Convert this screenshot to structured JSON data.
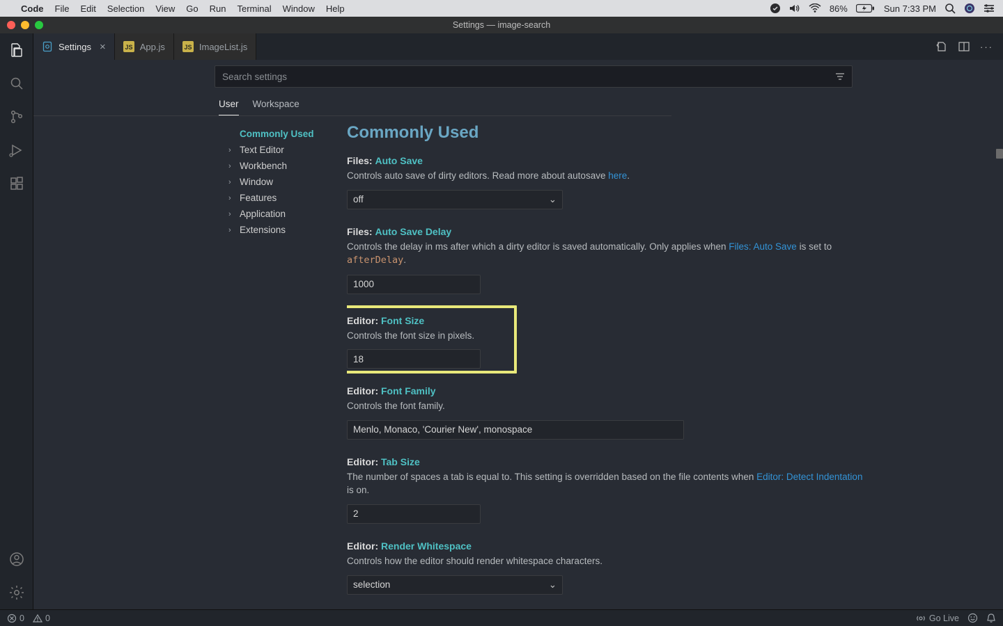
{
  "mac_menu": {
    "items": [
      "Code",
      "File",
      "Edit",
      "Selection",
      "View",
      "Go",
      "Run",
      "Terminal",
      "Window",
      "Help"
    ],
    "battery": "86%",
    "clock": "Sun 7:33 PM"
  },
  "title_bar": {
    "title": "Settings — image-search"
  },
  "tabs": {
    "items": [
      {
        "label": "Settings",
        "active": true,
        "icon": "settings"
      },
      {
        "label": "App.js",
        "active": false,
        "icon": "js"
      },
      {
        "label": "ImageList.js",
        "active": false,
        "icon": "js"
      }
    ]
  },
  "settings": {
    "search_placeholder": "Search settings",
    "scopes": [
      "User",
      "Workspace"
    ],
    "active_scope": 0,
    "toc": [
      "Commonly Used",
      "Text Editor",
      "Workbench",
      "Window",
      "Features",
      "Application",
      "Extensions"
    ],
    "active_toc": 0,
    "heading": "Commonly Used",
    "items": {
      "autosave": {
        "cat": "Files:",
        "name": "Auto Save",
        "desc_a": "Controls auto save of dirty editors. Read more about autosave ",
        "link": "here",
        "desc_b": ".",
        "value": "off"
      },
      "autosave_delay": {
        "cat": "Files:",
        "name": "Auto Save Delay",
        "desc_a": "Controls the delay in ms after which a dirty editor is saved automatically. Only applies when ",
        "link": "Files: Auto Save",
        "desc_b": " is set to ",
        "code": "afterDelay",
        "desc_c": ".",
        "value": "1000"
      },
      "font_size": {
        "cat": "Editor:",
        "name": "Font Size",
        "desc": "Controls the font size in pixels.",
        "value": "18"
      },
      "font_family": {
        "cat": "Editor:",
        "name": "Font Family",
        "desc": "Controls the font family.",
        "value": "Menlo, Monaco, 'Courier New', monospace"
      },
      "tab_size": {
        "cat": "Editor:",
        "name": "Tab Size",
        "desc_a": "The number of spaces a tab is equal to. This setting is overridden based on the file contents when ",
        "link": "Editor: Detect Indentation",
        "desc_b": " is on.",
        "value": "2"
      },
      "render_ws": {
        "cat": "Editor:",
        "name": "Render Whitespace",
        "desc": "Controls how the editor should render whitespace characters.",
        "value": "selection"
      }
    }
  },
  "status": {
    "errors": "0",
    "warnings": "0",
    "golive": "Go Live"
  }
}
